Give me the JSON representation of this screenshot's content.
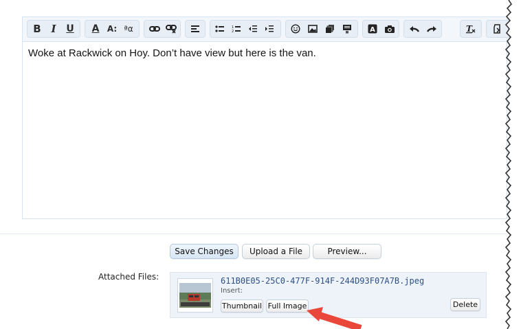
{
  "editor": {
    "toolbar_groups": [
      {
        "buttons": [
          {
            "icon": "bold-icon",
            "glyph": "B"
          },
          {
            "icon": "italic-icon",
            "glyph": "I"
          },
          {
            "icon": "underline-icon",
            "glyph": "U"
          }
        ]
      },
      {
        "buttons": [
          {
            "icon": "font-color-icon",
            "glyph": "A"
          },
          {
            "icon": "font-size-icon",
            "glyph": "A:"
          },
          {
            "icon": "font-family-icon",
            "glyph": "ªα"
          }
        ]
      },
      {
        "buttons": [
          {
            "icon": "link-icon"
          },
          {
            "icon": "unlink-icon"
          }
        ]
      },
      {
        "buttons": [
          {
            "icon": "align-left-icon"
          }
        ]
      },
      {
        "buttons": [
          {
            "icon": "bullet-list-icon"
          },
          {
            "icon": "numbered-list-icon"
          },
          {
            "icon": "outdent-icon"
          },
          {
            "icon": "indent-icon"
          }
        ]
      },
      {
        "buttons": [
          {
            "icon": "smiley-icon"
          },
          {
            "icon": "image-icon"
          },
          {
            "icon": "media-icon"
          },
          {
            "icon": "quote-icon"
          }
        ]
      },
      {
        "buttons": [
          {
            "icon": "code-icon"
          },
          {
            "icon": "camera-icon"
          }
        ]
      },
      {
        "buttons": [
          {
            "icon": "undo-icon"
          },
          {
            "icon": "redo-icon"
          }
        ]
      },
      {
        "buttons": [
          {
            "icon": "clear-formatting-icon"
          }
        ]
      },
      {
        "buttons": [
          {
            "icon": "toggle-bbcode-icon"
          }
        ]
      }
    ],
    "content": "Woke at Rackwick on Hoy. Don’t have view but here is the van."
  },
  "actions": {
    "save": "Save Changes",
    "upload": "Upload a File",
    "preview": "Preview..."
  },
  "attachments": {
    "label": "Attached Files:",
    "file": {
      "name": "611B0E05-25C0-477F-914F-244D93F07A7B.jpeg",
      "insert_label": "Insert:",
      "thumbnail_btn": "Thumbnail",
      "full_image_btn": "Full Image",
      "delete_btn": "Delete"
    }
  },
  "colors": {
    "accent": "#2c4f87",
    "arrow": "#e8473a",
    "editor_border": "#d6e3f0"
  }
}
